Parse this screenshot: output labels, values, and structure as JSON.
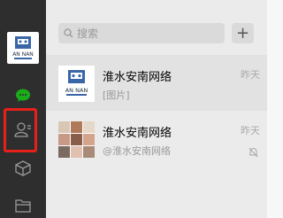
{
  "user": {
    "avatar_text": "AN NAN"
  },
  "search": {
    "placeholder": "搜索"
  },
  "add_label": "+",
  "chats": [
    {
      "name": "淮水安南网络",
      "preview": "[图片]",
      "time": "昨天"
    },
    {
      "name": "淮水安南网络",
      "preview": "@淮水安南网络",
      "time": "昨天",
      "muted": true
    }
  ],
  "colors": {
    "sidebar": "#2e2e2e",
    "accent_green": "#1aad19",
    "highlight_red": "#e8201a"
  }
}
